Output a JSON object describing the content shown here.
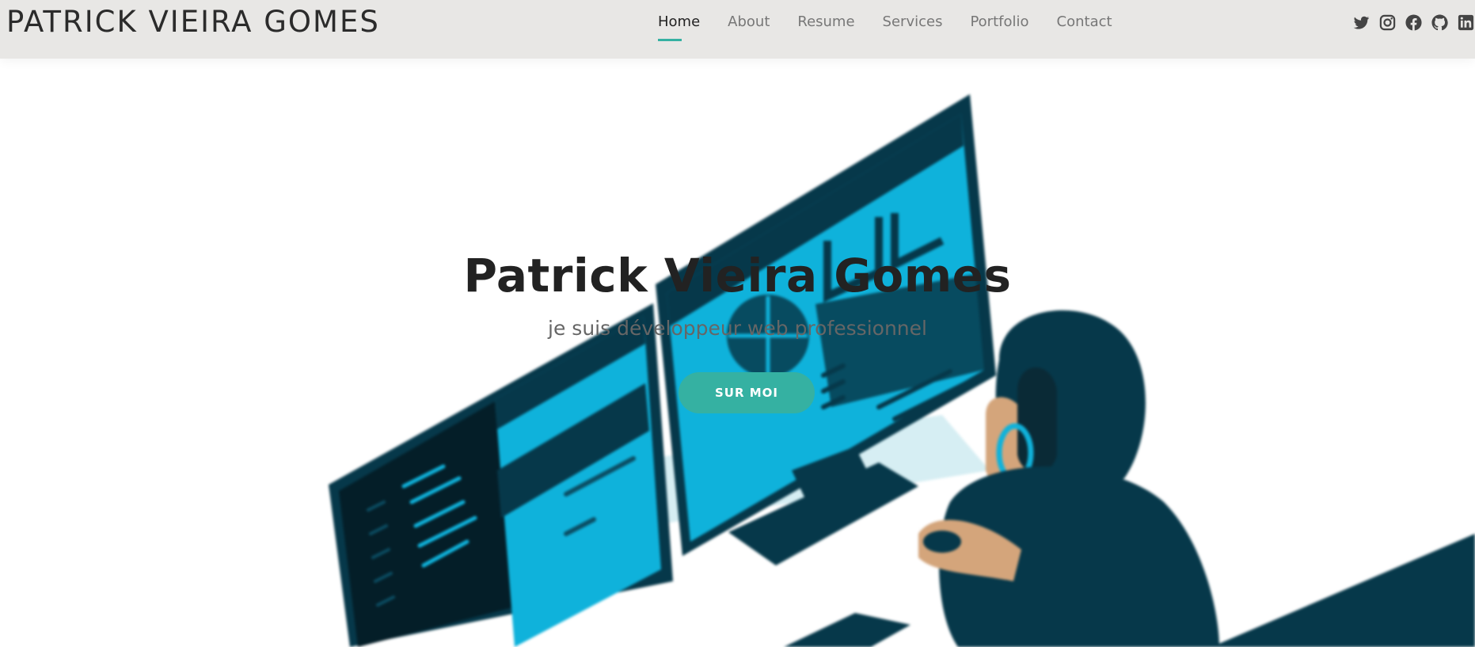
{
  "header": {
    "logo": "PATRICK VIEIRA GOMES",
    "nav": [
      {
        "label": "Home",
        "active": true
      },
      {
        "label": "About"
      },
      {
        "label": "Resume"
      },
      {
        "label": "Services"
      },
      {
        "label": "Portfolio"
      },
      {
        "label": "Contact"
      }
    ],
    "socials": [
      "twitter-icon",
      "instagram-icon",
      "facebook-icon",
      "github-icon",
      "linkedin-icon"
    ]
  },
  "hero": {
    "title": "Patrick Vieira Gomes",
    "subtitle": "je suis développeur web professionnel",
    "button": "SUR MOI"
  },
  "colors": {
    "accent": "#35b1a2",
    "header_bg": "#e8e7e5",
    "illustration_dark": "#06384a",
    "illustration_cyan": "#0fb2db"
  }
}
